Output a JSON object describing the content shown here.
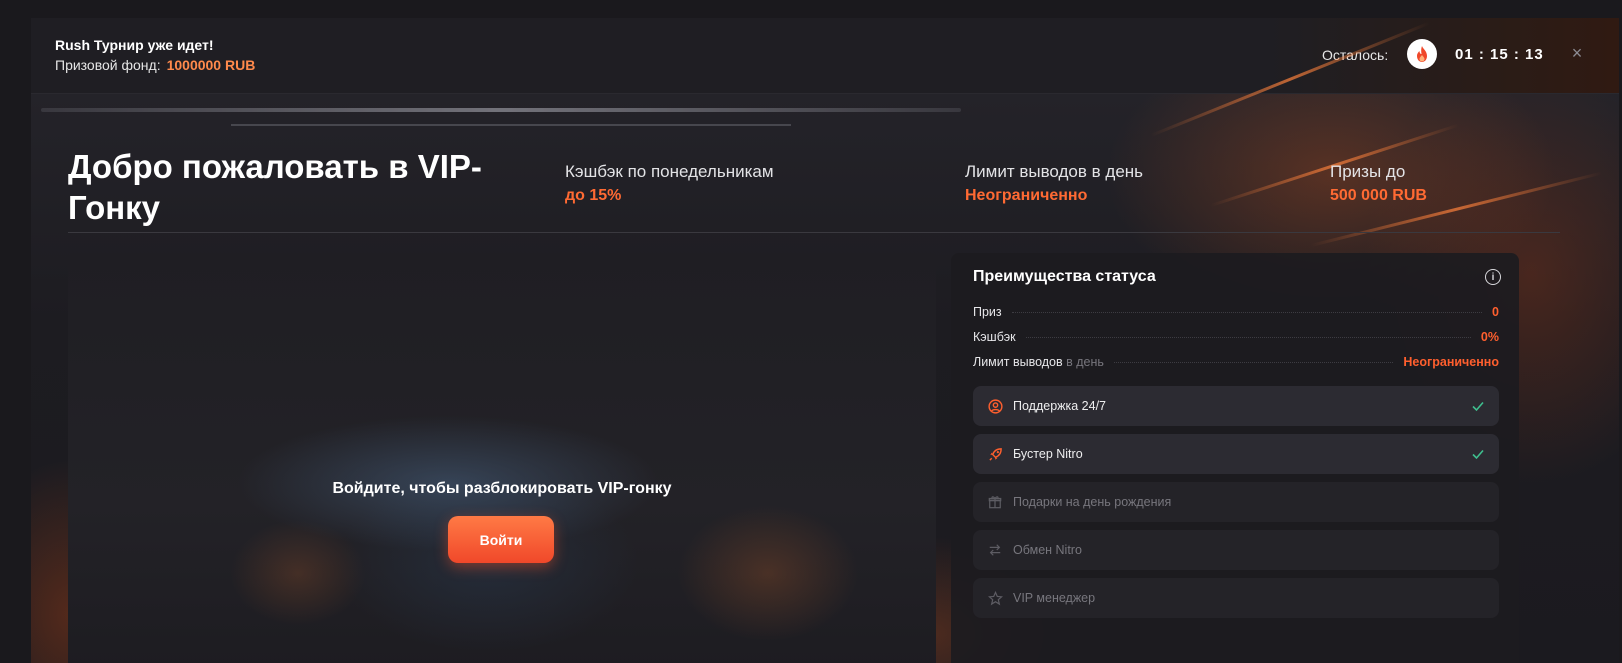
{
  "banner": {
    "title": "Rush Турнир уже идет!",
    "fund_label": "Призовой фонд:",
    "fund_value": "1000000 RUB",
    "remaining_label": "Осталось:",
    "timer": "01 : 15 : 13",
    "close_glyph": "×"
  },
  "hero": {
    "title": "Добро пожаловать в VIP-Гонку",
    "stats": [
      {
        "label": "Кэшбэк по понедельникам",
        "value": "до 15%"
      },
      {
        "label": "Лимит выводов в день",
        "value": "Неограниченно"
      },
      {
        "label": "Призы до",
        "value": "500 000 RUB"
      }
    ]
  },
  "locked": {
    "message": "Войдите, чтобы разблокировать VIP-гонку",
    "login_label": "Войти"
  },
  "benefits": {
    "title": "Преимущества статуса",
    "info_glyph": "i",
    "rows": [
      {
        "label": "Приз",
        "suffix": "",
        "value": "0"
      },
      {
        "label": "Кэшбэк",
        "suffix": "",
        "value": "0%"
      },
      {
        "label": "Лимит выводов",
        "suffix": "в день",
        "value": "Неограниченно"
      }
    ],
    "perks": [
      {
        "name": "Поддержка 24/7",
        "icon": "support-icon",
        "active": true
      },
      {
        "name": "Бустер Nitro",
        "icon": "rocket-icon",
        "active": true
      },
      {
        "name": "Подарки на день рождения",
        "icon": "gift-icon",
        "active": false
      },
      {
        "name": "Обмен Nitro",
        "icon": "exchange-icon",
        "active": false
      },
      {
        "name": "VIP менеджер",
        "icon": "star-icon",
        "active": false
      }
    ]
  },
  "colors": {
    "accent": "#ff5f2e",
    "check": "#3fbf8f",
    "background": "#1e1d22"
  }
}
